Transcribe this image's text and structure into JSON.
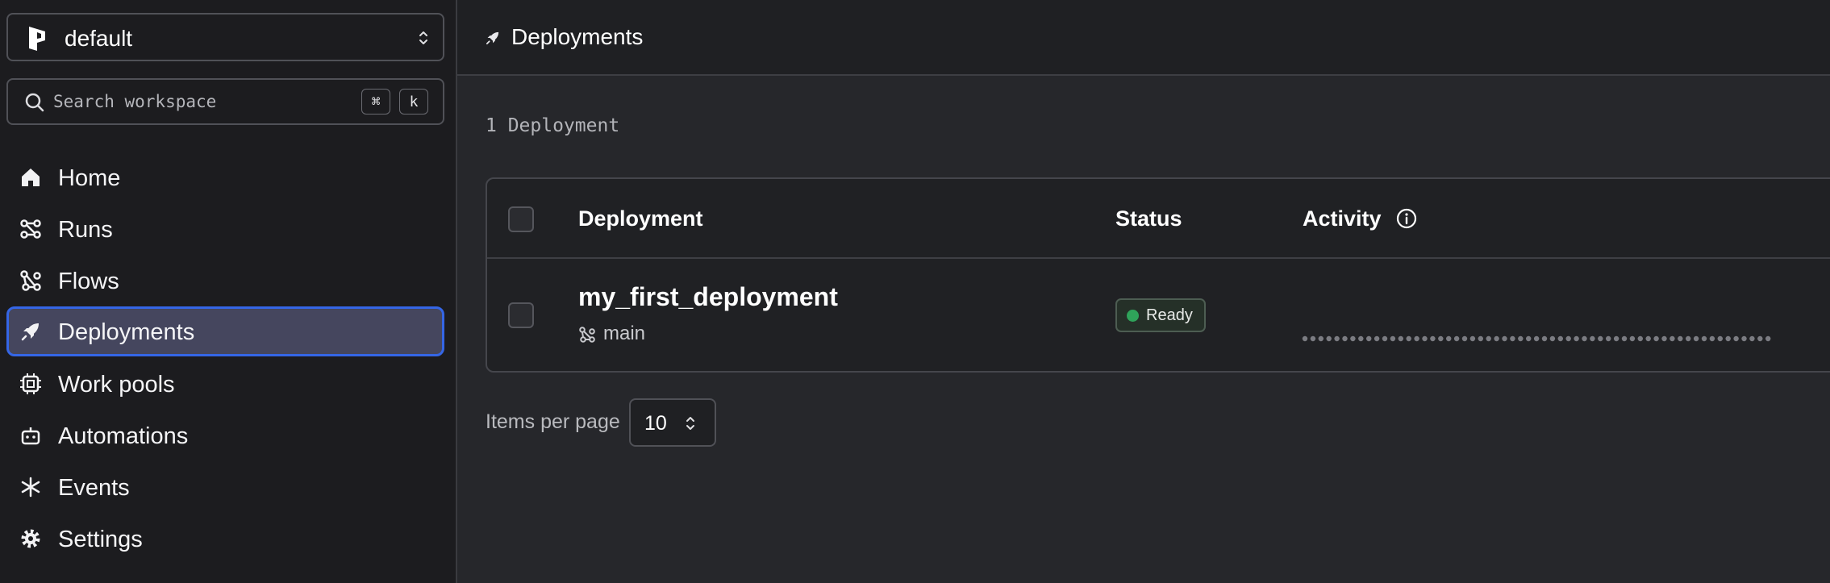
{
  "workspace": {
    "name": "default"
  },
  "search": {
    "placeholder": "Search workspace",
    "shortcut_mod": "⌘",
    "shortcut_key": "k"
  },
  "nav": {
    "items": [
      {
        "label": "Home",
        "icon": "home-icon"
      },
      {
        "label": "Runs",
        "icon": "runs-icon"
      },
      {
        "label": "Flows",
        "icon": "flows-icon"
      },
      {
        "label": "Deployments",
        "icon": "rocket-icon",
        "active": true
      },
      {
        "label": "Work pools",
        "icon": "cpu-icon"
      },
      {
        "label": "Automations",
        "icon": "bot-icon"
      },
      {
        "label": "Events",
        "icon": "asterisk-icon"
      },
      {
        "label": "Settings",
        "icon": "gear-icon"
      }
    ]
  },
  "page": {
    "title": "Deployments",
    "count_label": "1 Deployment"
  },
  "table": {
    "headers": {
      "deployment": "Deployment",
      "status": "Status",
      "activity": "Activity"
    },
    "rows": [
      {
        "name": "my_first_deployment",
        "branch": "main",
        "status": "Ready"
      }
    ]
  },
  "pagination": {
    "items_per_page_label": "Items per page",
    "items_per_page_value": "10"
  },
  "colors": {
    "accent": "#3566e6",
    "status_ready": "#2fa35a"
  }
}
